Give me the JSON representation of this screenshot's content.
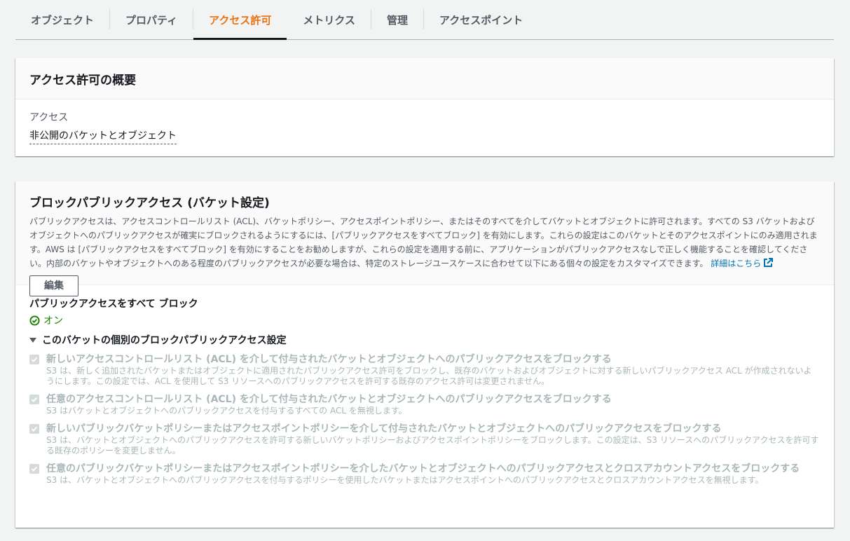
{
  "tabs": [
    {
      "label": "オブジェクト"
    },
    {
      "label": "プロパティ"
    },
    {
      "label": "アクセス許可"
    },
    {
      "label": "メトリクス"
    },
    {
      "label": "管理"
    },
    {
      "label": "アクセスポイント"
    }
  ],
  "active_tab": "アクセス許可",
  "overview": {
    "title": "アクセス許可の概要",
    "access_label": "アクセス",
    "access_value": "非公開のバケットとオブジェクト"
  },
  "block_public": {
    "title": "ブロックパブリックアクセス (バケット設定)",
    "description": "パブリックアクセスは、アクセスコントロールリスト (ACL)、バケットポリシー、アクセスポイントポリシー、またはそのすべてを介してバケットとオブジェクトに許可されます。すべての S3 バケットおよびオブジェクトへのパブリックアクセスが確実にブロックされるようにするには、[パブリックアクセスをすべてブロック] を有効にします。これらの設定はこのバケットとそのアクセスポイントにのみ適用されます。AWS は [パブリックアクセスをすべてブロック] を有効にすることをお勧めしますが、これらの設定を適用する前に、アプリケーションがパブリックアクセスなしで正しく機能することを確認してください。内部のバケットやオブジェクトへのある程度のパブリックアクセスが必要な場合は、特定のストレージユースケースに合わせて以下にある個々の設定をカスタマイズできます。",
    "learn_more": "詳細はこちら",
    "edit_button": "編集",
    "all_title": "パブリックアクセスをすべて ブロック",
    "all_status": "オン",
    "expander_label": "このバケットの個別のブロックパブリックアクセス設定",
    "options": [
      {
        "title": "新しいアクセスコントロールリスト (ACL) を介して付与されたバケットとオブジェクトへのパブリックアクセスをブロックする",
        "desc": "S3 は、新しく追加されたバケットまたはオブジェクトに適用されたパブリックアクセス許可をブロックし、既存のバケットおよびオブジェクトに対する新しいパブリックアクセス ACL が作成されないようにします。この設定では、ACL を使用して S3 リソースへのパブリックアクセスを許可する既存のアクセス許可は変更されません。"
      },
      {
        "title": "任意のアクセスコントロールリスト (ACL) を介して付与されたバケットとオブジェクトへのパブリックアクセスをブロックする",
        "desc": "S3 はバケットとオブジェクトへのパブリックアクセスを付与するすべての ACL を無視します。"
      },
      {
        "title": "新しいパブリックバケットポリシーまたはアクセスポイントポリシーを介して付与されたバケットとオブジェクトへのパブリックアクセスをブロックする",
        "desc": "S3 は、バケットとオブジェクトへのパブリックアクセスを許可する新しいバケットポリシーおよびアクセスポイントポリシーをブロックします。この設定は、S3 リソースへのパブリックアクセスを許可する既存のポリシーを変更しません。"
      },
      {
        "title": "任意のパブリックバケットポリシーまたはアクセスポイントポリシーを介したバケットとオブジェクトへのパブリックアクセスとクロスアカウントアクセスをブロックする",
        "desc": "S3 は、バケットとオブジェクトへのパブリックアクセスを付与するポリシーを使用したバケットまたはアクセスポイントへのパブリックアクセスとクロスアカウントアクセスを無視します。"
      }
    ]
  },
  "colors": {
    "accent": "#ec7211",
    "link": "#0073bb",
    "success": "#1d8102",
    "disabled": "#aab7b8"
  }
}
